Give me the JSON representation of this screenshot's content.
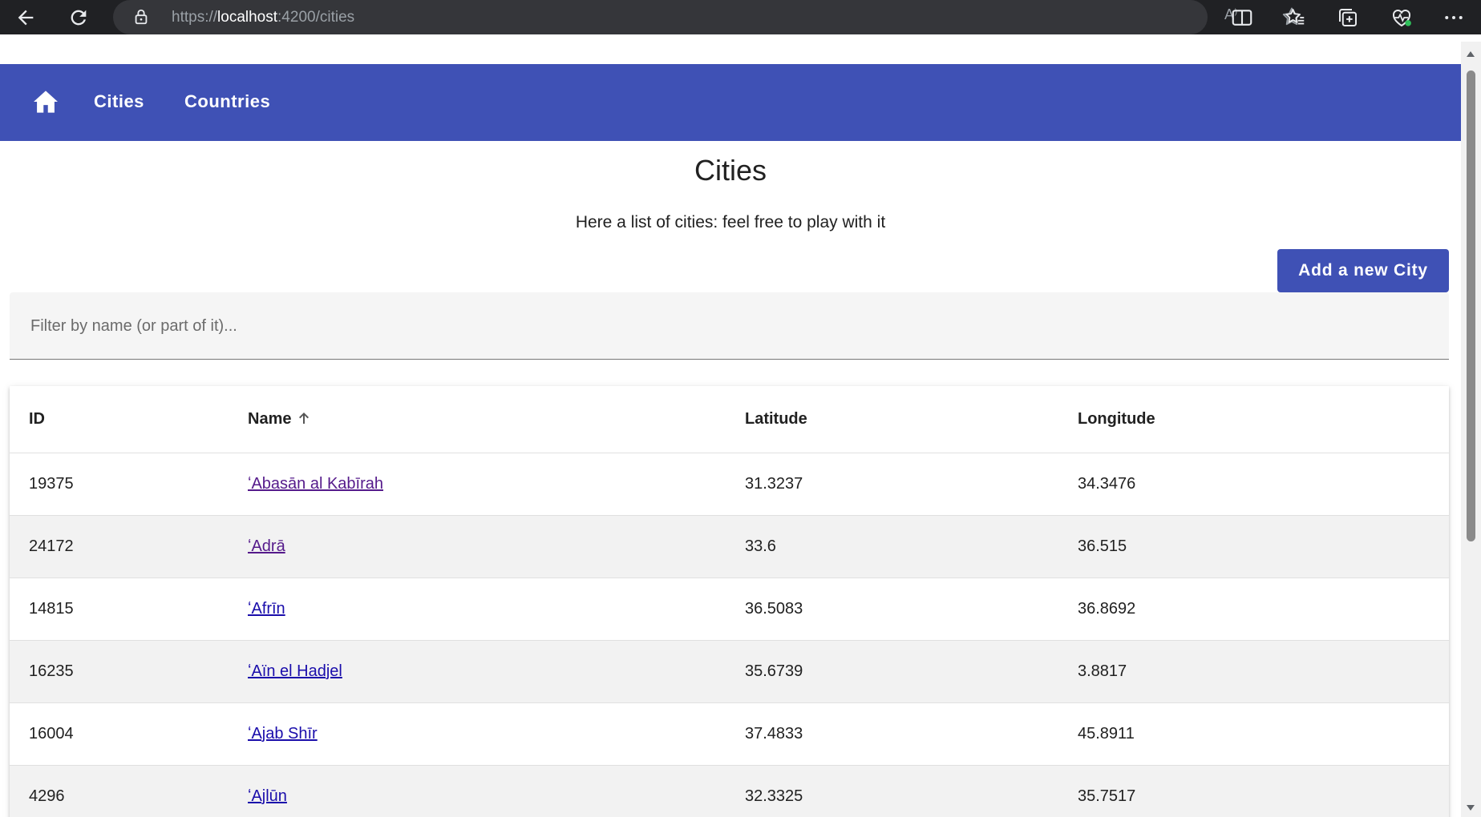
{
  "browser": {
    "url_scheme": "https://",
    "url_host": "localhost",
    "url_path": ":4200/cities",
    "read_aloud": "A⁾"
  },
  "nav": {
    "home_label": "home",
    "cities_label": "Cities",
    "countries_label": "Countries"
  },
  "page": {
    "title": "Cities",
    "subtitle": "Here a list of cities: feel free to play with it",
    "add_button": "Add a new City"
  },
  "filter": {
    "placeholder": "Filter by name (or part of it)...",
    "value": ""
  },
  "table": {
    "headers": {
      "id": "ID",
      "name": "Name",
      "latitude": "Latitude",
      "longitude": "Longitude"
    },
    "sort": {
      "column": "Name",
      "direction": "ascending"
    },
    "rows": [
      {
        "id": "19375",
        "name": "ʻAbasān al Kabīrah",
        "lat": "31.3237",
        "lon": "34.3476",
        "visited": true
      },
      {
        "id": "24172",
        "name": "ʻAdrā",
        "lat": "33.6",
        "lon": "36.515",
        "visited": true
      },
      {
        "id": "14815",
        "name": "ʻAfrīn",
        "lat": "36.5083",
        "lon": "36.8692",
        "visited": false
      },
      {
        "id": "16235",
        "name": "ʻAïn el Hadjel",
        "lat": "35.6739",
        "lon": "3.8817",
        "visited": false
      },
      {
        "id": "16004",
        "name": "ʻAjab Shīr",
        "lat": "37.4833",
        "lon": "45.8911",
        "visited": false
      },
      {
        "id": "4296",
        "name": "ʻAjlūn",
        "lat": "32.3325",
        "lon": "35.7517",
        "visited": false
      }
    ]
  },
  "colors": {
    "primary": "#3f51b5",
    "link": "#1a0dab",
    "link_visited": "#551a8b",
    "row_alt": "#f2f2f2"
  }
}
